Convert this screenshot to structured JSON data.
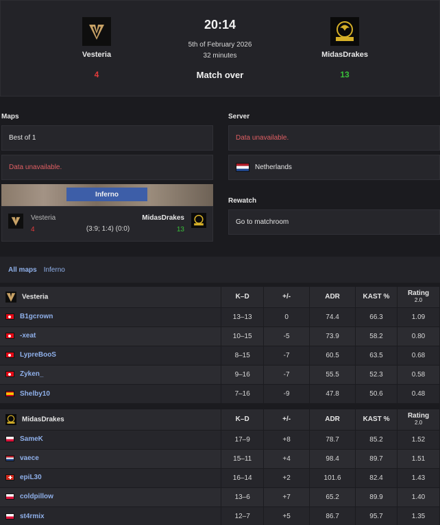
{
  "header": {
    "team1": {
      "name": "Vesteria",
      "score": "4",
      "logo": "vesteria-logo"
    },
    "team2": {
      "name": "MidasDrakes",
      "score": "13",
      "logo": "midasdrakes-logo"
    },
    "time": "20:14",
    "date": "5th of February 2026",
    "duration": "32 minutes",
    "status": "Match over"
  },
  "maps": {
    "label": "Maps",
    "format": "Best of 1",
    "notice": "Data unavailable.",
    "map_name": "Inferno",
    "team1_name": "Vesteria",
    "team1_score": "4",
    "team2_name": "MidasDrakes",
    "team2_score": "13",
    "halves": "(3:9; 1:4) (0:0)"
  },
  "server": {
    "label": "Server",
    "notice": "Data unavailable.",
    "country": "Netherlands"
  },
  "rewatch": {
    "label": "Rewatch",
    "link": "Go to matchroom"
  },
  "map_tabs": {
    "all": "All maps",
    "inferno": "Inferno"
  },
  "columns": {
    "kd": "K–D",
    "pm": "+/-",
    "adr": "ADR",
    "kast": "KAST %",
    "rating": "Rating",
    "rating_sub": "2.0"
  },
  "team1_stats": {
    "team": "Vesteria",
    "players": [
      {
        "flag": "tr",
        "name": "B1gcrown",
        "kd": "13–13",
        "pm": "0",
        "adr": "74.4",
        "kast": "66.3",
        "rating": "1.09"
      },
      {
        "flag": "tr",
        "name": "-xeat",
        "kd": "10–15",
        "pm": "-5",
        "adr": "73.9",
        "kast": "58.2",
        "rating": "0.80"
      },
      {
        "flag": "tr",
        "name": "LypreBooS",
        "kd": "8–15",
        "pm": "-7",
        "adr": "60.5",
        "kast": "63.5",
        "rating": "0.68"
      },
      {
        "flag": "tr",
        "name": "Zyken_",
        "kd": "9–16",
        "pm": "-7",
        "adr": "55.5",
        "kast": "52.3",
        "rating": "0.58"
      },
      {
        "flag": "es",
        "name": "Shelby10",
        "kd": "7–16",
        "pm": "-9",
        "adr": "47.8",
        "kast": "50.6",
        "rating": "0.48"
      }
    ]
  },
  "team2_stats": {
    "team": "MidasDrakes",
    "players": [
      {
        "flag": "pl",
        "name": "SameK",
        "kd": "17–9",
        "pm": "+8",
        "adr": "78.7",
        "kast": "85.2",
        "rating": "1.52"
      },
      {
        "flag": "nl",
        "name": "vaece",
        "kd": "15–11",
        "pm": "+4",
        "adr": "98.4",
        "kast": "89.7",
        "rating": "1.51"
      },
      {
        "flag": "ch",
        "name": "epiL30",
        "kd": "16–14",
        "pm": "+2",
        "adr": "101.6",
        "kast": "82.4",
        "rating": "1.43"
      },
      {
        "flag": "pl",
        "name": "coldpillow",
        "kd": "13–6",
        "pm": "+7",
        "adr": "65.2",
        "kast": "89.9",
        "rating": "1.40"
      },
      {
        "flag": "pl",
        "name": "st4rmix",
        "kd": "12–7",
        "pm": "+5",
        "adr": "86.7",
        "kast": "95.7",
        "rating": "1.35"
      }
    ]
  },
  "colors": {
    "win": "#39c039",
    "loss": "#e23b3b",
    "link": "#8fb0ea",
    "map_label": "#3d5ea8"
  }
}
